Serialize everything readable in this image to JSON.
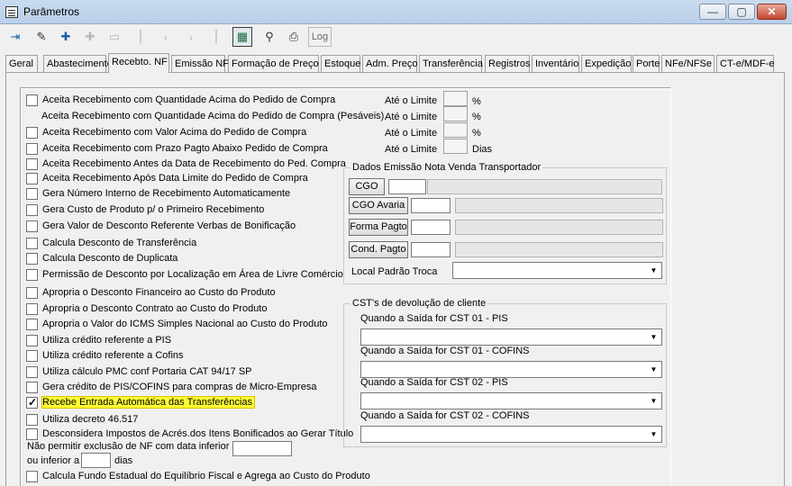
{
  "window": {
    "title": "Parâmetros",
    "min": "—",
    "max": "▢",
    "close": "✕"
  },
  "toolbar": {
    "log_label": "Log"
  },
  "tabs": [
    "Geral",
    "Abastecimento",
    "Recebto. NF",
    "Emissão NF",
    "Formação de Preço",
    "Estoque",
    "Adm. Preço",
    "Transferência",
    "Registros",
    "Inventário",
    "Expedição",
    "Porte",
    "NFe/NFSe",
    "CT-e/MDF-e"
  ],
  "active_tab": "Recebto. NF",
  "options": [
    {
      "label": "Aceita Recebimento com Quantidade Acima do Pedido de Compra",
      "checkbox": true,
      "checked": false
    },
    {
      "label": "Aceita Recebimento com Quantidade Acima do Pedido de Compra (Pesáveis)",
      "checkbox": false,
      "checked": false
    },
    {
      "label": "Aceita Recebimento com Valor Acima do Pedido de Compra",
      "checkbox": true,
      "checked": false
    },
    {
      "label": "Aceita Recebimento com Prazo Pagto Abaixo Pedido de Compra",
      "checkbox": true,
      "checked": false
    },
    {
      "label": "Aceita Recebimento Antes da Data de Recebimento do Ped. Compra",
      "checkbox": true,
      "checked": false
    },
    {
      "label": "Aceita Recebimento Após Data Limite do Pedido de Compra",
      "checkbox": true,
      "checked": false
    },
    {
      "label": "Gera Número Interno de Recebimento Automaticamente",
      "checkbox": true,
      "checked": false
    },
    {
      "label": "Gera Custo de Produto p/ o Primeiro Recebimento",
      "checkbox": true,
      "checked": false
    },
    {
      "label": "Gera Valor de Desconto Referente Verbas de Bonificação",
      "checkbox": true,
      "checked": false
    },
    {
      "label": "Calcula Desconto de Transferência",
      "checkbox": true,
      "checked": false
    },
    {
      "label": "Calcula Desconto de Duplicata",
      "checkbox": true,
      "checked": false
    },
    {
      "label": "Permissão de Desconto por Localização em Área de Livre Comércio",
      "checkbox": true,
      "checked": false
    },
    {
      "label": "Apropria o Desconto Financeiro ao Custo do Produto",
      "checkbox": true,
      "checked": false
    },
    {
      "label": "Apropria o Desconto Contrato ao Custo do Produto",
      "checkbox": true,
      "checked": false
    },
    {
      "label": "Apropria o Valor do ICMS Simples Nacional ao Custo do Produto",
      "checkbox": true,
      "checked": false
    },
    {
      "label": "Utiliza crédito referente a PIS",
      "checkbox": true,
      "checked": false
    },
    {
      "label": "Utiliza crédito referente a Cofins",
      "checkbox": true,
      "checked": false
    },
    {
      "label": "Utiliza cálculo PMC conf Portaria CAT 94/17 SP",
      "checkbox": true,
      "checked": false
    },
    {
      "label": "Gera crédito de PIS/COFINS para compras de Micro-Empresa",
      "checkbox": true,
      "checked": false
    },
    {
      "label": "Recebe Entrada Automática das Transferências",
      "checkbox": true,
      "checked": true,
      "highlighted": true
    },
    {
      "label": "Utiliza decreto 46.517",
      "checkbox": true,
      "checked": false
    },
    {
      "label": "Desconsidera Impostos de Acrés.dos Itens Bonificados ao Gerar Título",
      "checkbox": true,
      "checked": false
    }
  ],
  "limits": [
    {
      "label": "Até o Limite",
      "unit": "%"
    },
    {
      "label": "Até o Limite",
      "unit": "%"
    },
    {
      "label": "Até o Limite",
      "unit": "%"
    },
    {
      "label": "Até o Limite",
      "unit": "Dias"
    }
  ],
  "nf_exclusion": {
    "line1": "Não permitir exclusão de NF com data inferior à",
    "line2": "ou inferior a",
    "days": "dias"
  },
  "last_option": {
    "label": "Calcula Fundo Estadual do Equilíbrio Fiscal e  Agrega ao Custo do Produto",
    "checked": false
  },
  "transport_group": {
    "title": "Dados Emissão Nota Venda Transportador",
    "buttons": [
      "CGO",
      "CGO Avaria",
      "Forma Pagto",
      "Cond. Pagto"
    ],
    "local_label": "Local Padrão Troca"
  },
  "cst_group": {
    "title": "CST's de devolução de cliente",
    "fields": [
      "Quando a Saída for CST 01 - PIS",
      "Quando a Saída for CST 01 - COFINS",
      "Quando a Saída for CST 02 - PIS",
      "Quando a Saída for CST 02 - COFINS"
    ]
  }
}
